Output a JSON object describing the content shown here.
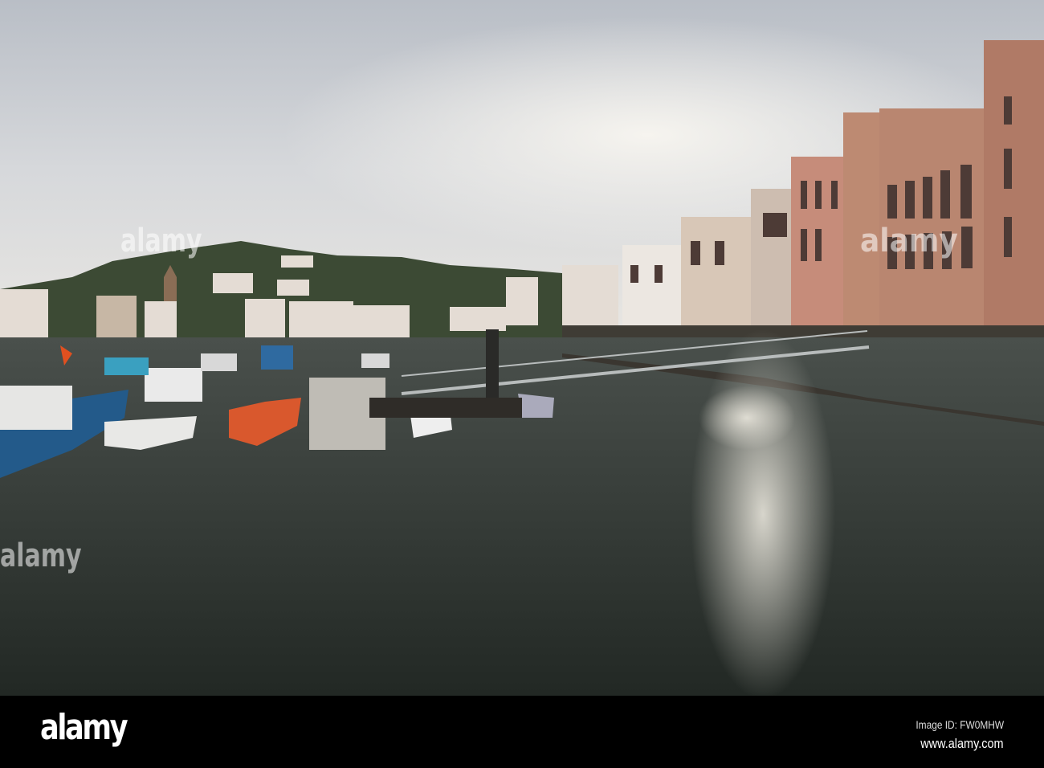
{
  "photo": {
    "subject": "harbour-with-boats-and-footbridge"
  },
  "watermark": {
    "brand": "alamy"
  },
  "footer": {
    "logo": "alamy",
    "image_id": "Image ID: FW0MHW",
    "website": "www.alamy.com"
  },
  "colors": {
    "sky": "#c9cdd3",
    "water": "#2e3530",
    "building": "#b57e6a",
    "footer": "#000000"
  }
}
